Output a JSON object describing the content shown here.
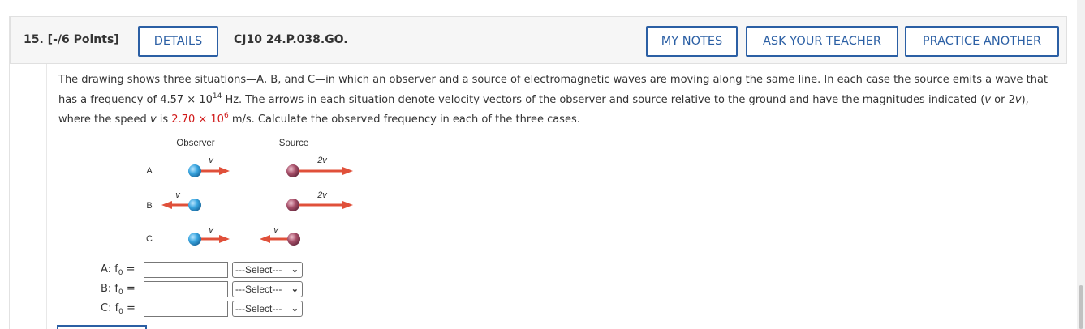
{
  "question": {
    "title": "15. [-/6 Points]",
    "code": "CJ10 24.P.038.GO."
  },
  "buttons": {
    "details": "DETAILS",
    "my_notes": "MY NOTES",
    "ask_teacher": "ASK YOUR TEACHER",
    "practice_another": "PRACTICE ANOTHER"
  },
  "problem": {
    "line1": "The drawing shows three situations—A, B, and C—in which an observer and a source of electromagnetic waves are moving along the same line. In each case the source emits a wave that",
    "line2_a": "has a frequency of 4.57 × 10",
    "line2_exp": "14",
    "line2_b": " Hz. The arrows in each situation denote velocity vectors of the observer and source relative to the ground and have the magnitudes indicated (",
    "line2_v": "v",
    "line2_c": " or 2",
    "line2_v2": "v",
    "line2_d": "),",
    "line3_a": "where the speed ",
    "line3_v": "v",
    "line3_b": " is ",
    "speed_value": "2.70 × 10",
    "speed_exp": "6",
    "line3_c": " m/s. Calculate the observed frequency in each of the three cases."
  },
  "diagram": {
    "observer_header": "Observer",
    "source_header": "Source",
    "rows": [
      {
        "label": "A",
        "observer_vel": "v",
        "source_vel": "2v"
      },
      {
        "label": "B",
        "observer_vel": "v",
        "source_vel": "2v"
      },
      {
        "label": "C",
        "observer_vel": "v",
        "source_vel": "v"
      }
    ],
    "colors": {
      "observer": "#3aa6e0",
      "source": "#a8506a",
      "arrow": "#e0503a"
    }
  },
  "answers": [
    {
      "label": "A: f",
      "sub": "0",
      "eq": " =",
      "select": "---Select---"
    },
    {
      "label": "B: f",
      "sub": "0",
      "eq": " =",
      "select": "---Select---"
    },
    {
      "label": "C: f",
      "sub": "0",
      "eq": " =",
      "select": "---Select---"
    }
  ]
}
